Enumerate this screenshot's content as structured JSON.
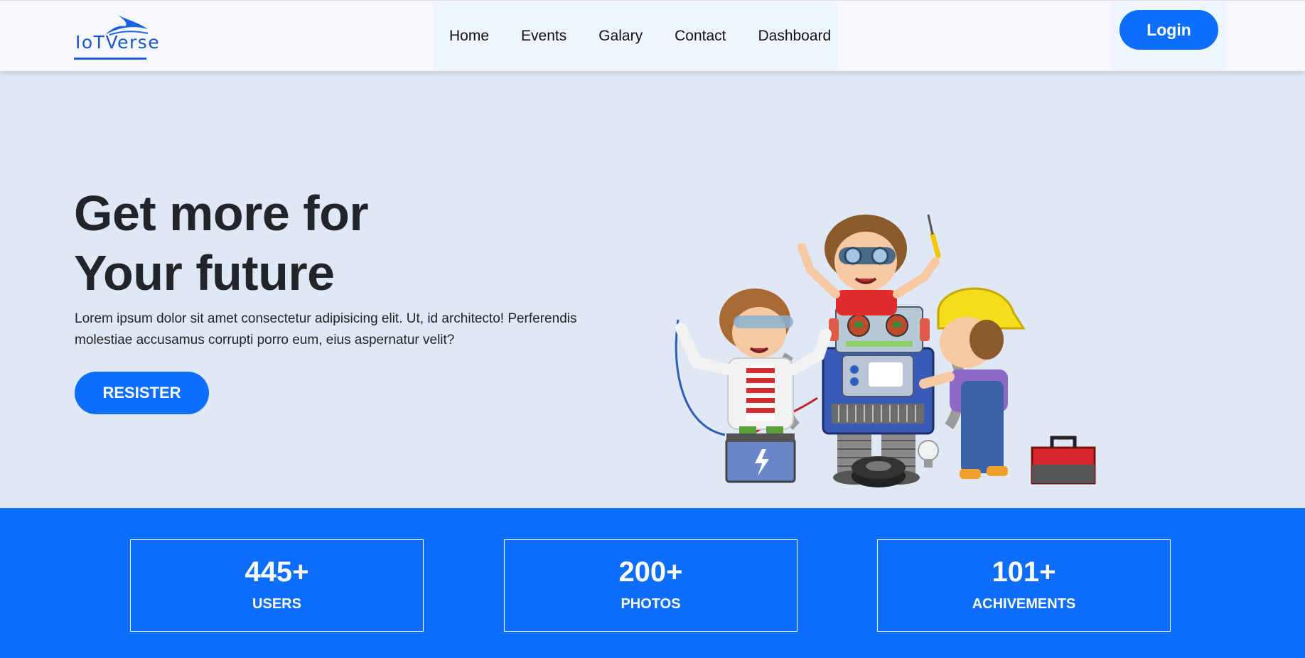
{
  "brand": {
    "name": "IoTVerse",
    "color": "#1a55c9"
  },
  "nav": {
    "items": [
      {
        "label": "Home"
      },
      {
        "label": "Events"
      },
      {
        "label": "Galary"
      },
      {
        "label": "Contact"
      },
      {
        "label": "Dashboard"
      }
    ],
    "login_label": "Login"
  },
  "hero": {
    "title_line1": "Get more for",
    "title_line2": "Your future",
    "text_line1": "Lorem ipsum dolor sit amet consectetur adipisicing elit. Ut, id architecto! Perferendis",
    "text_line2": "molestiae accusamus corrupti porro eum, eius aspernatur velit?",
    "register_label": "RESISTER",
    "illustration": "kids-building-robot"
  },
  "stats": [
    {
      "value": "445+",
      "label": "USERS"
    },
    {
      "value": "200+",
      "label": "PHOTOS"
    },
    {
      "value": "101+",
      "label": "ACHIVEMENTS"
    }
  ],
  "colors": {
    "accent": "#0d6efd",
    "hero_bg": "#e0e7f5",
    "navbar_bg": "#f6f8fb"
  }
}
